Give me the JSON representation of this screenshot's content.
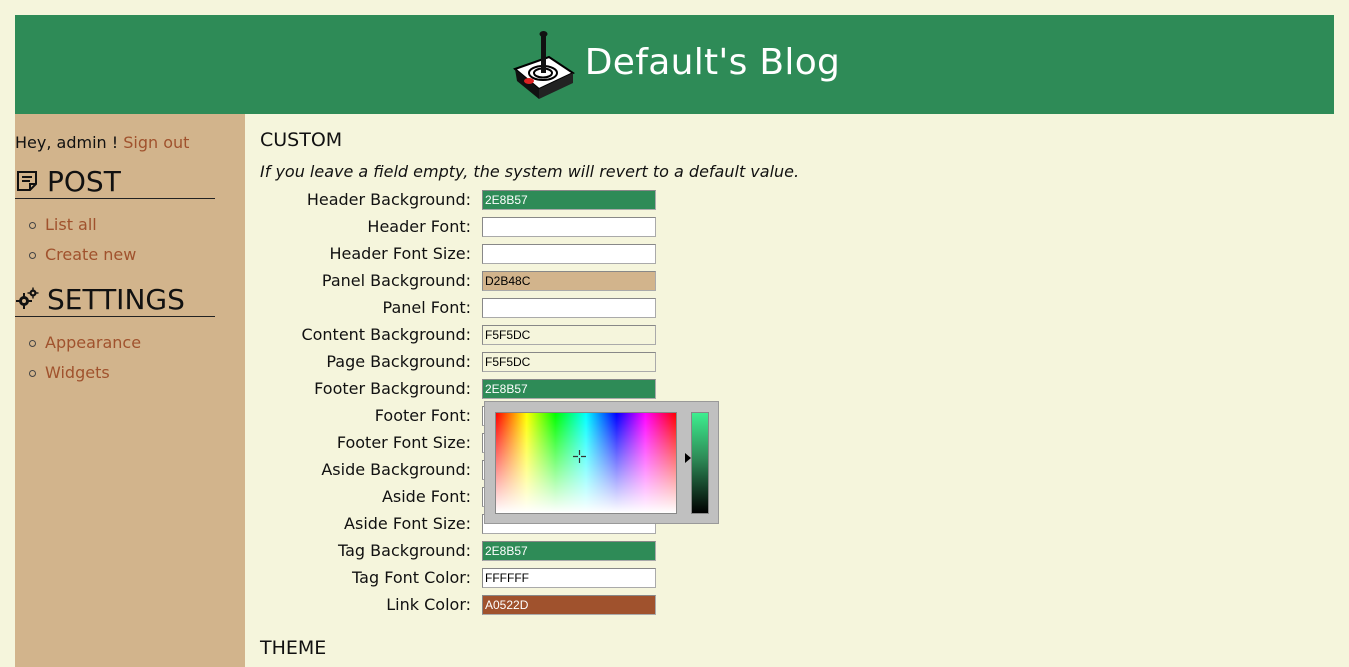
{
  "header": {
    "title": "Default's Blog",
    "background": "#2E8B57",
    "logo_icon": "joystick-icon"
  },
  "aside": {
    "greeting": "Hey, admin !",
    "signout_label": "Sign out",
    "sections": [
      {
        "icon": "note-icon",
        "title": "POST",
        "items": [
          "List all",
          "Create new"
        ]
      },
      {
        "icon": "gears-icon",
        "title": "SETTINGS",
        "items": [
          "Appearance",
          "Widgets"
        ]
      }
    ]
  },
  "main": {
    "custom_heading": "CUSTOM",
    "note": "If you leave a field empty, the system will revert to a default value.",
    "fields": [
      {
        "label": "Header Background:",
        "value": "2E8B57",
        "bg": "#2E8B57",
        "fg": "#ffffff"
      },
      {
        "label": "Header Font:",
        "value": "",
        "bg": "#ffffff",
        "fg": "#000000"
      },
      {
        "label": "Header Font Size:",
        "value": "",
        "bg": "#ffffff",
        "fg": "#000000"
      },
      {
        "label": "Panel Background:",
        "value": "D2B48C",
        "bg": "#D2B48C",
        "fg": "#000000"
      },
      {
        "label": "Panel Font:",
        "value": "",
        "bg": "#ffffff",
        "fg": "#000000"
      },
      {
        "label": "Content Background:",
        "value": "F5F5DC",
        "bg": "#F5F5DC",
        "fg": "#000000"
      },
      {
        "label": "Page Background:",
        "value": "F5F5DC",
        "bg": "#F5F5DC",
        "fg": "#000000"
      },
      {
        "label": "Footer Background:",
        "value": "2E8B57",
        "bg": "#2E8B57",
        "fg": "#ffffff"
      },
      {
        "label": "Footer Font:",
        "value": "",
        "bg": "#ffffff",
        "fg": "#000000"
      },
      {
        "label": "Footer Font Size:",
        "value": "",
        "bg": "#ffffff",
        "fg": "#000000"
      },
      {
        "label": "Aside Background:",
        "value": "",
        "bg": "#ffffff",
        "fg": "#000000"
      },
      {
        "label": "Aside Font:",
        "value": "",
        "bg": "#ffffff",
        "fg": "#000000"
      },
      {
        "label": "Aside Font Size:",
        "value": "",
        "bg": "#ffffff",
        "fg": "#000000"
      },
      {
        "label": "Tag Background:",
        "value": "2E8B57",
        "bg": "#2E8B57",
        "fg": "#ffffff"
      },
      {
        "label": "Tag Font Color:",
        "value": "FFFFFF",
        "bg": "#ffffff",
        "fg": "#000000"
      },
      {
        "label": "Link Color:",
        "value": "A0522D",
        "bg": "#A0522D",
        "fg": "#ffffff"
      }
    ],
    "theme_heading": "THEME"
  },
  "colors": {
    "link": "#A0522D",
    "panel": "#D2B48C",
    "page": "#F5F5DC"
  }
}
